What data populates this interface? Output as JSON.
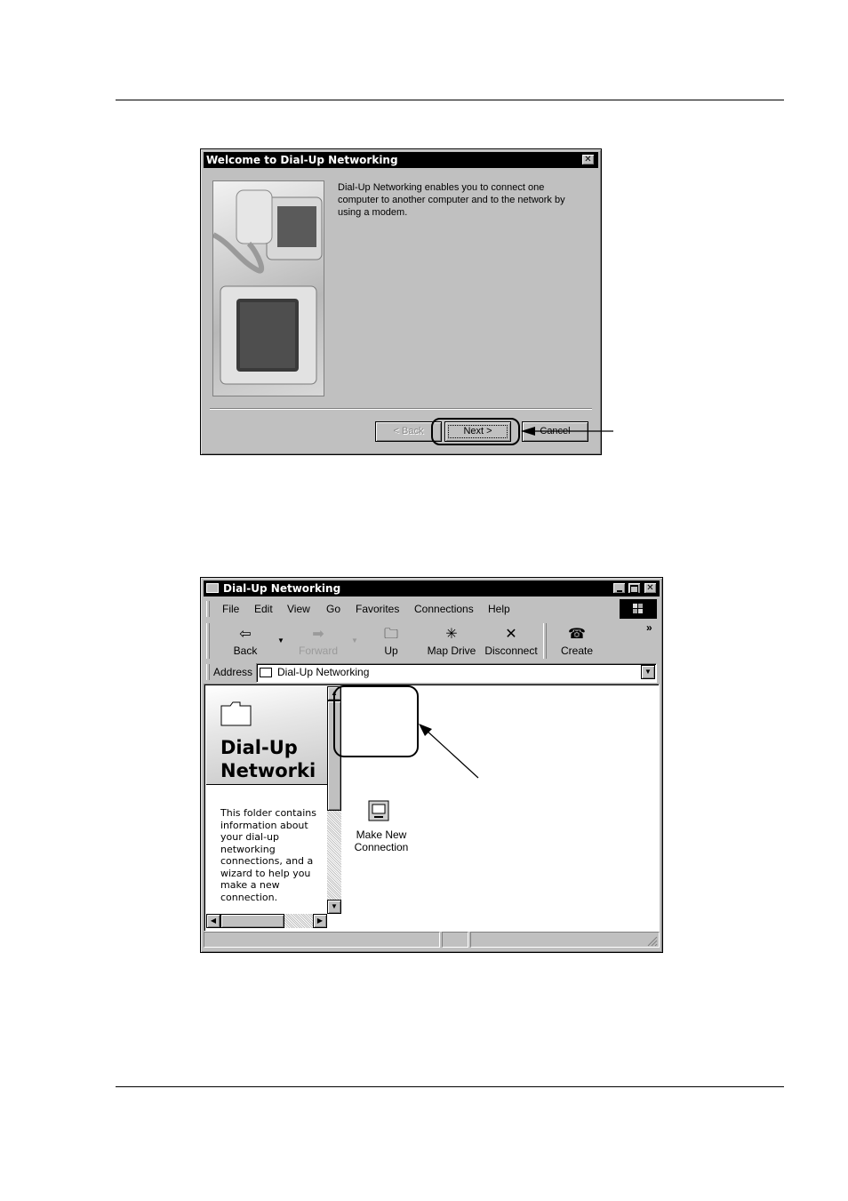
{
  "dialog": {
    "title": "Welcome to Dial-Up Networking",
    "close_glyph": "✕",
    "description": "Dial-Up Networking enables you to connect one computer to another computer and to the network by using a modem.",
    "back_label": "< Back",
    "next_label": "Next >",
    "cancel_label": "Cancel"
  },
  "explorer": {
    "title": "Dial-Up Networking",
    "menu": [
      "File",
      "Edit",
      "View",
      "Go",
      "Favorites",
      "Connections",
      "Help"
    ],
    "toolbar": {
      "back": "Back",
      "forward": "Forward",
      "up": "Up",
      "map_drive": "Map Drive",
      "disconnect": "Disconnect",
      "create": "Create",
      "more": "»"
    },
    "address_label": "Address",
    "address_value": "Dial-Up Networking",
    "side_title_line1": "Dial-Up",
    "side_title_line2": "Networki",
    "side_description": "This folder contains information about your dial-up networking connections, and a wizard to help you make a new connection.",
    "icon_label_line1": "Make New",
    "icon_label_line2": "Connection"
  }
}
